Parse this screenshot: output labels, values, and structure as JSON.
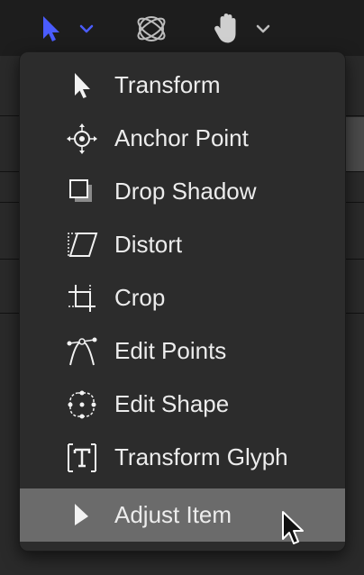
{
  "toolbar": {
    "tools": [
      {
        "icon": "select-arrow-icon",
        "color": "#4a5cff"
      },
      {
        "icon": "orbit-3d-icon"
      },
      {
        "icon": "hand-pan-icon"
      }
    ]
  },
  "menu": {
    "items": [
      {
        "label": "Transform",
        "icon": "transform-arrow-icon"
      },
      {
        "label": "Anchor Point",
        "icon": "anchor-point-icon"
      },
      {
        "label": "Drop Shadow",
        "icon": "drop-shadow-icon"
      },
      {
        "label": "Distort",
        "icon": "distort-icon"
      },
      {
        "label": "Crop",
        "icon": "crop-icon"
      },
      {
        "label": "Edit Points",
        "icon": "edit-points-icon"
      },
      {
        "label": "Edit Shape",
        "icon": "edit-shape-icon"
      },
      {
        "label": "Transform Glyph",
        "icon": "transform-glyph-icon"
      },
      {
        "label": "Adjust Item",
        "icon": "adjust-item-icon",
        "selected": true
      }
    ]
  },
  "colors": {
    "accent": "#4a5cff",
    "menu_bg": "#2c2c2c",
    "selected_bg": "#6b6b6b",
    "text": "#ececec"
  }
}
